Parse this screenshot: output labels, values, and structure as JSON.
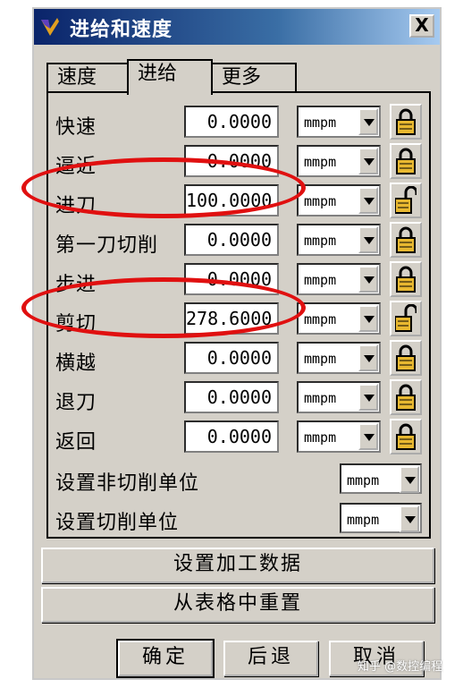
{
  "window": {
    "title": "进给和速度",
    "close_label": "X"
  },
  "tabs": [
    {
      "label": "速度",
      "active": false
    },
    {
      "label": "进给",
      "active": true
    },
    {
      "label": "更多",
      "active": false
    }
  ],
  "feed_rows": [
    {
      "label": "快速",
      "value": "0.0000",
      "unit": "mmpm",
      "locked": true
    },
    {
      "label": "逼近",
      "value": "0.0000",
      "unit": "mmpm",
      "locked": true
    },
    {
      "label": "进刀",
      "value": "100.0000",
      "unit": "mmpm",
      "locked": false
    },
    {
      "label": "第一刀切削",
      "value": "0.0000",
      "unit": "mmpm",
      "locked": true
    },
    {
      "label": "步进",
      "value": "0.0000",
      "unit": "mmpm",
      "locked": true
    },
    {
      "label": "剪切",
      "value": "278.6000",
      "unit": "mmpm",
      "locked": false
    },
    {
      "label": "横越",
      "value": "0.0000",
      "unit": "mmpm",
      "locked": true
    },
    {
      "label": "退刀",
      "value": "0.0000",
      "unit": "mmpm",
      "locked": true
    },
    {
      "label": "返回",
      "value": "0.0000",
      "unit": "mmpm",
      "locked": true
    }
  ],
  "unit_settings": [
    {
      "label": "设置非切削单位",
      "unit": "mmpm"
    },
    {
      "label": "设置切削单位",
      "unit": "mmpm"
    }
  ],
  "actions": {
    "set_machining_data": "设置加工数据",
    "reset_from_table": "从表格中重置"
  },
  "footer": {
    "ok": "确定",
    "back": "后退",
    "cancel": "取消"
  },
  "watermark": "知乎 @数控编程",
  "colors": {
    "highlight_ellipse": "#e01010",
    "titlebar": "#0a246a",
    "lock_gold": "#e8b830"
  }
}
